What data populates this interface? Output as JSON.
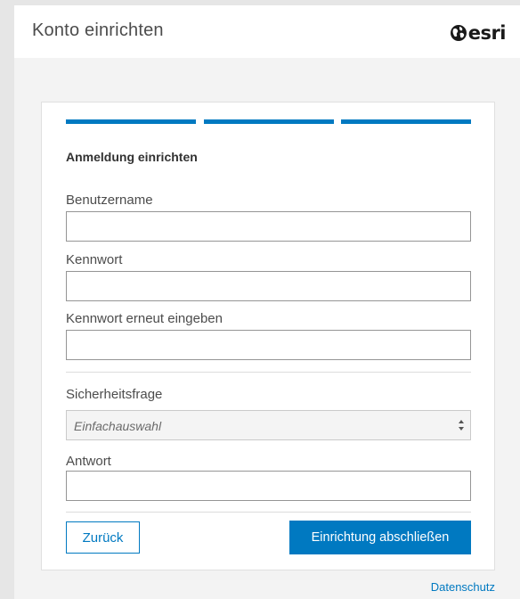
{
  "header": {
    "title": "Konto einrichten",
    "logo_text": "esri",
    "logo_icon": "globe-icon"
  },
  "form": {
    "progress_steps": [
      {
        "state": "complete"
      },
      {
        "state": "complete"
      },
      {
        "state": "current"
      }
    ],
    "section_heading": "Anmeldung einrichten",
    "username": {
      "label": "Benutzername",
      "value": "",
      "placeholder": ""
    },
    "password": {
      "label": "Kennwort",
      "value": "",
      "placeholder": ""
    },
    "password_confirm": {
      "label": "Kennwort erneut eingeben",
      "value": "",
      "placeholder": ""
    },
    "security_question": {
      "label": "Sicherheitsfrage",
      "selected": "Einfachauswahl"
    },
    "answer": {
      "label": "Antwort",
      "value": "",
      "placeholder": ""
    },
    "back_button": "Zurück",
    "finish_button": "Einrichtung abschließen"
  },
  "footer": {
    "privacy_link": "Datenschutz"
  },
  "colors": {
    "accent": "#0079c1",
    "page_background": "#e6e6e6",
    "card_background": "#ffffff",
    "input_border": "#959595"
  }
}
